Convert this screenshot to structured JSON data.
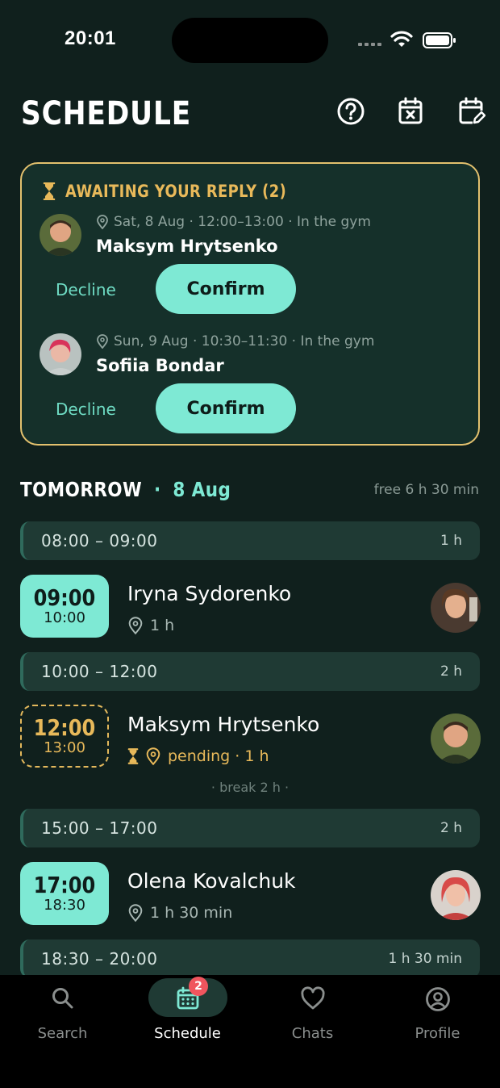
{
  "status_bar": {
    "time": "20:01"
  },
  "header": {
    "title": "SCHEDULE"
  },
  "pending": {
    "heading": "AWAITING YOUR REPLY (2)",
    "requests": [
      {
        "meta": "Sat, 8 Aug · 12:00–13:00 · In the gym",
        "name": "Maksym Hrytsenko",
        "decline_label": "Decline",
        "confirm_label": "Confirm"
      },
      {
        "meta": "Sun, 9 Aug · 10:30–11:30 · In the gym",
        "name": "Sofiia Bondar",
        "decline_label": "Decline",
        "confirm_label": "Confirm"
      }
    ]
  },
  "day": {
    "label": "TOMORROW",
    "separator": "·",
    "date": "8 Aug",
    "free": "free 6 h 30 min"
  },
  "slots": [
    {
      "time": "08:00 – 09:00",
      "duration": "1 h"
    },
    {
      "time": "10:00 – 12:00",
      "duration": "2 h"
    },
    {
      "time": "15:00 – 17:00",
      "duration": "2 h"
    },
    {
      "time": "18:30 – 20:00",
      "duration": "1 h 30 min"
    }
  ],
  "bookings": [
    {
      "start": "09:00",
      "end": "10:00",
      "name": "Iryna Sydorenko",
      "detail": "1 h",
      "status": "confirmed"
    },
    {
      "start": "12:00",
      "end": "13:00",
      "name": "Maksym Hrytsenko",
      "detail": "pending · 1 h",
      "status": "pending"
    },
    {
      "start": "17:00",
      "end": "18:30",
      "name": "Olena Kovalchuk",
      "detail": "1 h 30 min",
      "status": "confirmed"
    }
  ],
  "break_note": "· break 2 h ·",
  "tabs": [
    {
      "label": "Search",
      "icon": "search-icon"
    },
    {
      "label": "Schedule",
      "icon": "calendar-icon",
      "badge": "2",
      "active": true
    },
    {
      "label": "Chats",
      "icon": "heart-icon"
    },
    {
      "label": "Profile",
      "icon": "user-circle-icon"
    }
  ],
  "colors": {
    "background": "#10201d",
    "accent": "#7ee9d4",
    "pending": "#e8b95a",
    "badge": "#f0555e"
  }
}
